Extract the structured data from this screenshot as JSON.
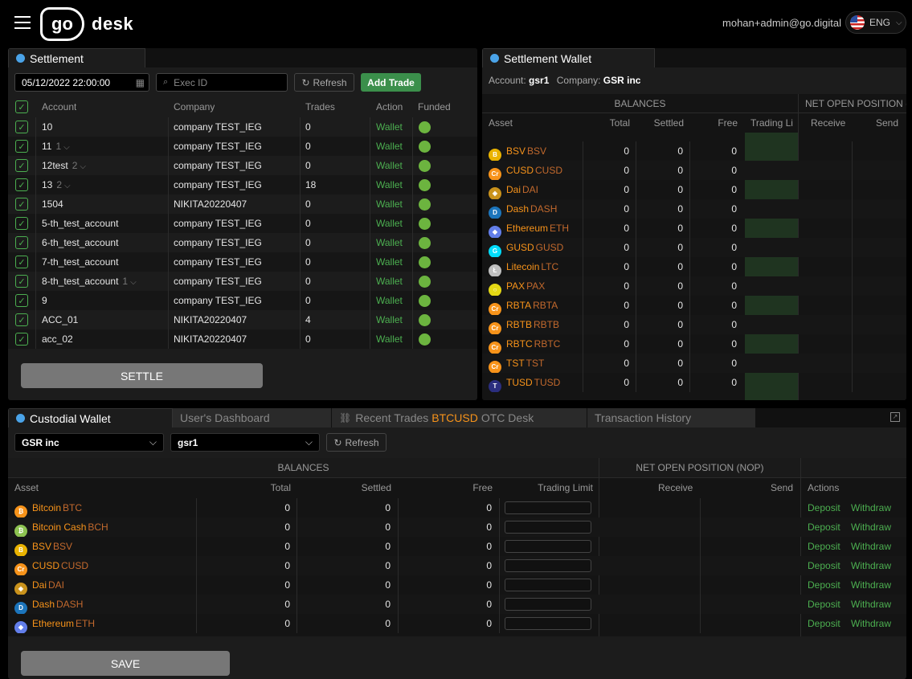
{
  "header": {
    "brand_mark": "go",
    "brand_name": "desk",
    "user_email": "mohan+admin@go.digital",
    "language": "ENG"
  },
  "settlement": {
    "tab_label": "Settlement",
    "date_value": "05/12/2022 22:00:00",
    "exec_placeholder": "Exec ID",
    "refresh_label": "Refresh",
    "add_trade_label": "Add Trade",
    "columns": [
      "Account",
      "Company",
      "Trades",
      "Action",
      "Funded"
    ],
    "rows": [
      {
        "account": "10",
        "sub": "",
        "company": "company TEST_IEG",
        "trades": "0",
        "action": "Wallet"
      },
      {
        "account": "11",
        "sub": "1",
        "company": "company TEST_IEG",
        "trades": "0",
        "action": "Wallet"
      },
      {
        "account": "12test",
        "sub": "2",
        "company": "company TEST_IEG",
        "trades": "0",
        "action": "Wallet"
      },
      {
        "account": "13",
        "sub": "2",
        "company": "company TEST_IEG",
        "trades": "18",
        "action": "Wallet"
      },
      {
        "account": "1504",
        "sub": "",
        "company": "NIKITA20220407",
        "trades": "0",
        "action": "Wallet"
      },
      {
        "account": "5-th_test_account",
        "sub": "",
        "company": "company TEST_IEG",
        "trades": "0",
        "action": "Wallet"
      },
      {
        "account": "6-th_test_account",
        "sub": "",
        "company": "company TEST_IEG",
        "trades": "0",
        "action": "Wallet"
      },
      {
        "account": "7-th_test_account",
        "sub": "",
        "company": "company TEST_IEG",
        "trades": "0",
        "action": "Wallet"
      },
      {
        "account": "8-th_test_account",
        "sub": "1",
        "company": "company TEST_IEG",
        "trades": "0",
        "action": "Wallet"
      },
      {
        "account": "9",
        "sub": "",
        "company": "company TEST_IEG",
        "trades": "0",
        "action": "Wallet"
      },
      {
        "account": "ACC_01",
        "sub": "",
        "company": "NIKITA20220407",
        "trades": "4",
        "action": "Wallet"
      },
      {
        "account": "acc_02",
        "sub": "",
        "company": "NIKITA20220407",
        "trades": "0",
        "action": "Wallet"
      }
    ],
    "settle_label": "SETTLE"
  },
  "settlement_wallet": {
    "tab_label": "Settlement Wallet",
    "account_label": "Account:",
    "account_value": "gsr1",
    "company_label": "Company:",
    "company_value": "GSR inc",
    "group_balances": "BALANCES",
    "group_nop": "NET OPEN POSITION (",
    "columns": [
      "Asset",
      "Total",
      "Settled",
      "Free",
      "Trading Li",
      "Receive",
      "Send"
    ],
    "rows": [
      {
        "name": "BSV",
        "sym": "BSV",
        "icon": "bsv-icon",
        "color": "#eab300",
        "glyph": "B",
        "total": "0",
        "settled": "0",
        "free": "0"
      },
      {
        "name": "CUSD",
        "sym": "CUSD",
        "icon": "cusd-icon",
        "color": "#f7931a",
        "glyph": "Cr",
        "total": "0",
        "settled": "0",
        "free": "0"
      },
      {
        "name": "Dai",
        "sym": "DAI",
        "icon": "dai-icon",
        "color": "#c9921c",
        "glyph": "◈",
        "total": "0",
        "settled": "0",
        "free": "0"
      },
      {
        "name": "Dash",
        "sym": "DASH",
        "icon": "dash-icon",
        "color": "#1c75bc",
        "glyph": "D",
        "total": "0",
        "settled": "0",
        "free": "0"
      },
      {
        "name": "Ethereum",
        "sym": "ETH",
        "icon": "ethereum-icon",
        "color": "#627eea",
        "glyph": "◆",
        "total": "0",
        "settled": "0",
        "free": "0"
      },
      {
        "name": "GUSD",
        "sym": "GUSD",
        "icon": "gusd-icon",
        "color": "#00dcfa",
        "glyph": "G",
        "total": "0",
        "settled": "0",
        "free": "0"
      },
      {
        "name": "Litecoin",
        "sym": "LTC",
        "icon": "litecoin-icon",
        "color": "#bfbfbf",
        "glyph": "Ł",
        "total": "0",
        "settled": "0",
        "free": "0"
      },
      {
        "name": "PAX",
        "sym": "PAX",
        "icon": "pax-icon",
        "color": "#e4d814",
        "glyph": "○",
        "total": "0",
        "settled": "0",
        "free": "0"
      },
      {
        "name": "RBTA",
        "sym": "RBTA",
        "icon": "rbta-icon",
        "color": "#f7931a",
        "glyph": "Cr",
        "total": "0",
        "settled": "0",
        "free": "0"
      },
      {
        "name": "RBTB",
        "sym": "RBTB",
        "icon": "rbtb-icon",
        "color": "#f7931a",
        "glyph": "Cr",
        "total": "0",
        "settled": "0",
        "free": "0"
      },
      {
        "name": "RBTC",
        "sym": "RBTC",
        "icon": "rbtc-icon",
        "color": "#f7931a",
        "glyph": "Cr",
        "total": "0",
        "settled": "0",
        "free": "0"
      },
      {
        "name": "TST",
        "sym": "TST",
        "icon": "tst-icon",
        "color": "#f7931a",
        "glyph": "Cr",
        "total": "0",
        "settled": "0",
        "free": "0"
      },
      {
        "name": "TUSD",
        "sym": "TUSD",
        "icon": "tusd-icon",
        "color": "#2b2e7f",
        "glyph": "T",
        "total": "0",
        "settled": "0",
        "free": "0"
      }
    ]
  },
  "custodial": {
    "tabs": {
      "custodial": "Custodial Wallet",
      "dashboard": "User's Dashboard",
      "recent_prefix": "Recent Trades ",
      "recent_pair": "BTCUSD",
      "recent_suffix": " OTC Desk",
      "history": "Transaction History"
    },
    "company_select": "GSR inc",
    "account_select": "gsr1",
    "refresh_label": "Refresh",
    "group_balances": "BALANCES",
    "group_nop": "NET OPEN POSITION (NOP)",
    "columns": [
      "Asset",
      "Total",
      "Settled",
      "Free",
      "Trading Limit",
      "Receive",
      "Send",
      "Actions"
    ],
    "deposit_label": "Deposit",
    "withdraw_label": "Withdraw",
    "rows": [
      {
        "name": "Bitcoin",
        "sym": "BTC",
        "icon": "bitcoin-icon",
        "color": "#f7931a",
        "glyph": "₿",
        "total": "0",
        "settled": "0",
        "free": "0"
      },
      {
        "name": "Bitcoin Cash",
        "sym": "BCH",
        "icon": "bitcoin-cash-icon",
        "color": "#8dc351",
        "glyph": "₿",
        "total": "0",
        "settled": "0",
        "free": "0"
      },
      {
        "name": "BSV",
        "sym": "BSV",
        "icon": "bsv-icon",
        "color": "#eab300",
        "glyph": "B",
        "total": "0",
        "settled": "0",
        "free": "0"
      },
      {
        "name": "CUSD",
        "sym": "CUSD",
        "icon": "cusd-icon",
        "color": "#f7931a",
        "glyph": "Cr",
        "total": "0",
        "settled": "0",
        "free": "0"
      },
      {
        "name": "Dai",
        "sym": "DAI",
        "icon": "dai-icon",
        "color": "#c9921c",
        "glyph": "◈",
        "total": "0",
        "settled": "0",
        "free": "0"
      },
      {
        "name": "Dash",
        "sym": "DASH",
        "icon": "dash-icon",
        "color": "#1c75bc",
        "glyph": "D",
        "total": "0",
        "settled": "0",
        "free": "0"
      },
      {
        "name": "Ethereum",
        "sym": "ETH",
        "icon": "ethereum-icon",
        "color": "#627eea",
        "glyph": "◆",
        "total": "0",
        "settled": "0",
        "free": "0"
      }
    ],
    "save_label": "SAVE"
  }
}
